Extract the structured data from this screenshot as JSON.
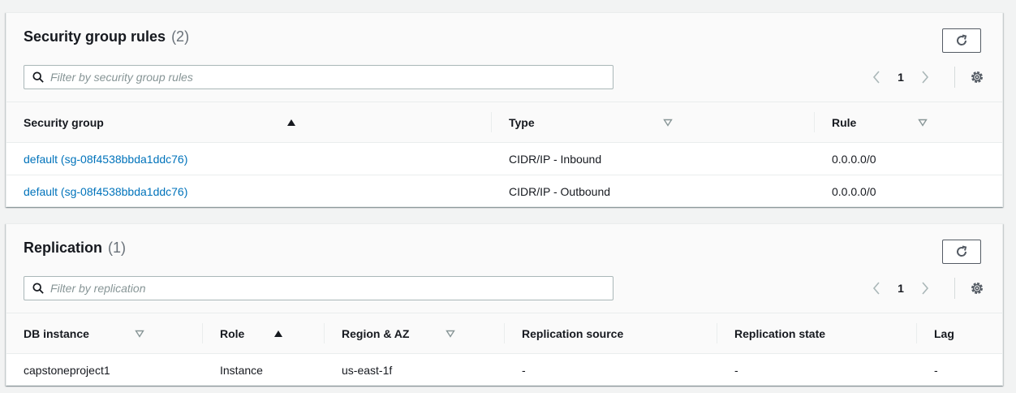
{
  "security_panel": {
    "title": "Security group rules",
    "count": "(2)",
    "filter_placeholder": "Filter by security group rules",
    "page": "1",
    "columns": [
      "Security group",
      "Type",
      "Rule"
    ],
    "rows": [
      {
        "group": "default (sg-08f4538bbda1ddc76)",
        "type": "CIDR/IP - Inbound",
        "rule": "0.0.0.0/0"
      },
      {
        "group": "default (sg-08f4538bbda1ddc76)",
        "type": "CIDR/IP - Outbound",
        "rule": "0.0.0.0/0"
      }
    ]
  },
  "replication_panel": {
    "title": "Replication",
    "count": "(1)",
    "filter_placeholder": "Filter by replication",
    "page": "1",
    "columns": [
      "DB instance",
      "Role",
      "Region & AZ",
      "Replication source",
      "Replication state",
      "Lag"
    ],
    "rows": [
      {
        "db_instance": "capstoneproject1",
        "role": "Instance",
        "region": "us-east-1f",
        "source": "-",
        "state": "-",
        "lag": "-"
      }
    ]
  },
  "icons": {
    "refresh": "refresh-icon",
    "search": "search-icon",
    "prev": "chevron-left-icon",
    "next": "chevron-right-icon",
    "settings": "gear-icon",
    "sort_asc": "sort-ascending-icon",
    "sort_none": "sort-unsorted-icon"
  },
  "colors": {
    "link": "#0073bb",
    "header_bg": "#fafafa",
    "page_bg": "#f2f3f3"
  }
}
